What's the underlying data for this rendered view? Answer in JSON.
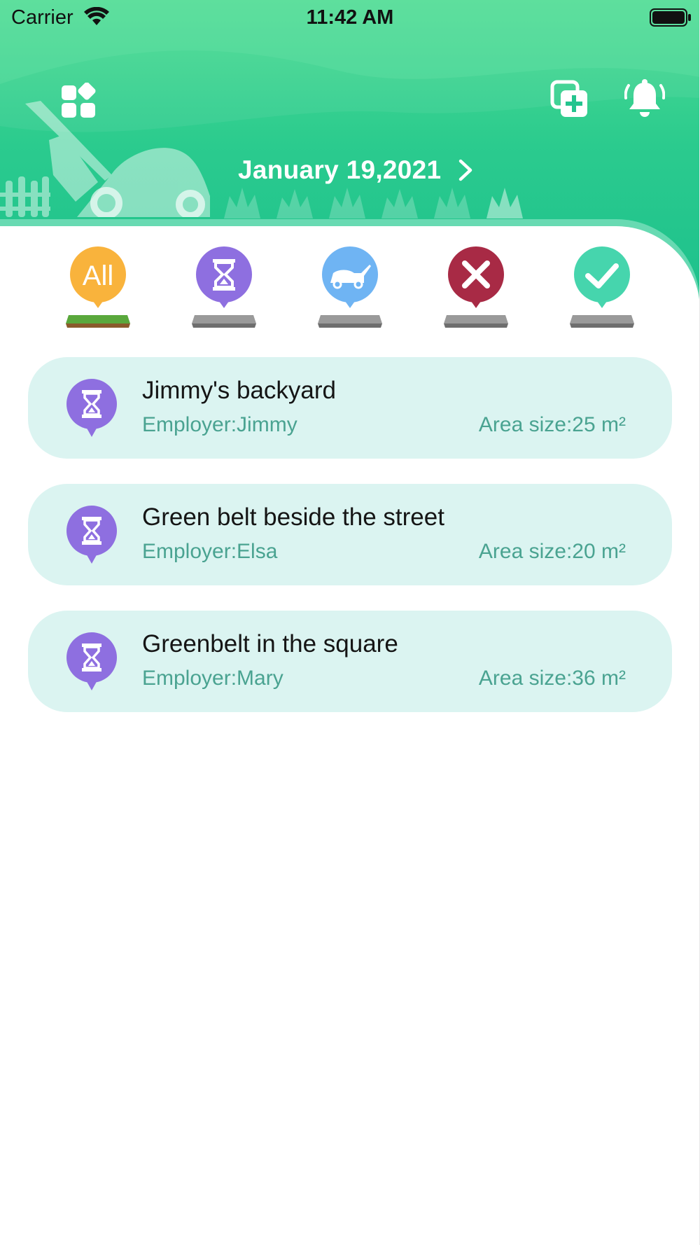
{
  "status_bar": {
    "carrier": "Carrier",
    "time": "11:42 AM"
  },
  "header": {
    "date": "January 19,2021",
    "icons": [
      "apps-grid-icon",
      "add-task-icon",
      "notification-bell-icon",
      "chevron-right-icon"
    ]
  },
  "filters": [
    {
      "label": "All",
      "icon": "all-filter-icon",
      "color": "#f9b33c",
      "selected": true
    },
    {
      "label": "",
      "icon": "hourglass-icon",
      "color": "#8e6fe0",
      "selected": false
    },
    {
      "label": "",
      "icon": "lawn-mower-icon",
      "color": "#6fb4f3",
      "selected": false
    },
    {
      "label": "",
      "icon": "close-icon",
      "color": "#a82a45",
      "selected": false
    },
    {
      "label": "",
      "icon": "checkmark-icon",
      "color": "#46d5ad",
      "selected": false
    }
  ],
  "jobs": [
    {
      "title": "Jimmy's backyard",
      "employer": "Employer:Jimmy",
      "area": "Area size:25 m²",
      "status_icon": "hourglass-icon"
    },
    {
      "title": "Green belt beside the street",
      "employer": "Employer:Elsa",
      "area": "Area size:20 m²",
      "status_icon": "hourglass-icon"
    },
    {
      "title": "Greenbelt in the square",
      "employer": "Employer:Mary",
      "area": "Area size:36 m²",
      "status_icon": "hourglass-icon"
    }
  ],
  "colors": {
    "header_green": "#2bcb8e",
    "card_bg": "#dbf4f1",
    "secondary_text": "#4aa391",
    "pending_purple": "#8e6fe0"
  }
}
